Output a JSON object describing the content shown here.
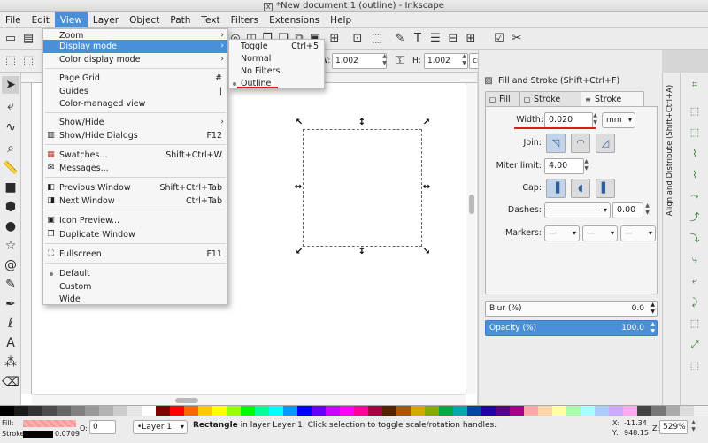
{
  "window": {
    "title": "*New document 1 (outline) - Inkscape"
  },
  "menubar": [
    "File",
    "Edit",
    "View",
    "Layer",
    "Object",
    "Path",
    "Text",
    "Filters",
    "Extensions",
    "Help"
  ],
  "view_menu": {
    "items": [
      {
        "label": "Zoom",
        "submenu": true
      },
      {
        "label": "Display mode",
        "submenu": true,
        "highlighted": true
      },
      {
        "label": "Color display mode",
        "submenu": true
      },
      {
        "label": "Page Grid",
        "accel": "#"
      },
      {
        "label": "Guides",
        "accel": "|"
      },
      {
        "label": "Color-managed view"
      },
      {
        "label": "Show/Hide",
        "submenu": true
      },
      {
        "label": "Show/Hide Dialogs",
        "accel": "F12",
        "icon": "show-hide-dialogs-icon"
      },
      {
        "label": "Swatches...",
        "accel": "Shift+Ctrl+W",
        "icon": "swatches-icon"
      },
      {
        "label": "Messages...",
        "icon": "messages-icon"
      },
      {
        "label": "Previous Window",
        "accel": "Shift+Ctrl+Tab",
        "icon": "previous-window-icon"
      },
      {
        "label": "Next Window",
        "accel": "Ctrl+Tab",
        "icon": "next-window-icon"
      },
      {
        "label": "Icon Preview...",
        "icon": "icon-preview-icon"
      },
      {
        "label": "Duplicate Window",
        "icon": "duplicate-window-icon"
      },
      {
        "label": "Fullscreen",
        "accel": "F11",
        "icon": "fullscreen-icon"
      },
      {
        "label": "Default",
        "selected": true
      },
      {
        "label": "Custom"
      },
      {
        "label": "Wide"
      }
    ]
  },
  "display_submenu": {
    "items": [
      {
        "label": "Toggle",
        "accel": "Ctrl+5"
      },
      {
        "label": "Normal"
      },
      {
        "label": "No Filters"
      },
      {
        "label": "Outline",
        "selected": true
      }
    ]
  },
  "control_bar": {
    "w_label": "W:",
    "w_value": "1.002",
    "h_label": "H:",
    "h_value": "1.002",
    "unit": "cm"
  },
  "dock": {
    "title": "Fill and Stroke (Shift+Ctrl+F)",
    "tabs": [
      "Fill",
      "Stroke paint",
      "Stroke style"
    ],
    "active_tab": "Stroke style",
    "width_label": "Width:",
    "width_value": "0.020",
    "width_unit": "mm",
    "join_label": "Join:",
    "miter_label": "Miter limit:",
    "miter_value": "4.00",
    "cap_label": "Cap:",
    "dashes_label": "Dashes:",
    "dashes_value": "0.00",
    "markers_label": "Markers:",
    "blur_label": "Blur (%)",
    "blur_value": "0.0",
    "opacity_label": "Opacity (%)",
    "opacity_value": "100.0"
  },
  "side_panel": {
    "align_tab": "Align and Distribute (Shift+Ctrl+A)"
  },
  "statusbar": {
    "fill_label": "Fill:",
    "stroke_label": "Stroke:",
    "stroke_width": "0.0709",
    "o_label": "O:",
    "o_value": "0",
    "layer": "•Layer 1",
    "message_bold": "Rectangle",
    "message": "in layer Layer 1. Click selection to toggle scale/rotation handles.",
    "x_label": "X:",
    "x_value": "-11.34",
    "y_label": "Y:",
    "y_value": "948.15",
    "z_label": "Z:",
    "zoom": "529%"
  },
  "palette_colors": [
    "#000000",
    "#1a1a1a",
    "#333333",
    "#4d4d4d",
    "#666666",
    "#808080",
    "#999999",
    "#b3b3b3",
    "#cccccc",
    "#e6e6e6",
    "#ffffff",
    "#800000",
    "#ff0000",
    "#ff6600",
    "#ffcc00",
    "#ffff00",
    "#99ff00",
    "#00ff00",
    "#00ff99",
    "#00ffff",
    "#0099ff",
    "#0000ff",
    "#6600ff",
    "#cc00ff",
    "#ff00ff",
    "#ff0099",
    "#aa0044",
    "#552200",
    "#aa5500",
    "#d4aa00",
    "#88aa00",
    "#00aa44",
    "#00aaaa",
    "#0044aa",
    "#2200aa",
    "#550088",
    "#aa0088",
    "#ffaaaa",
    "#ffd5aa",
    "#ffffaa",
    "#aaffaa",
    "#aaffff",
    "#aaccff",
    "#ccaaff",
    "#ffaaee",
    "#444444",
    "#777777",
    "#aaaaaa",
    "#dddddd",
    "#f0f0f0"
  ]
}
